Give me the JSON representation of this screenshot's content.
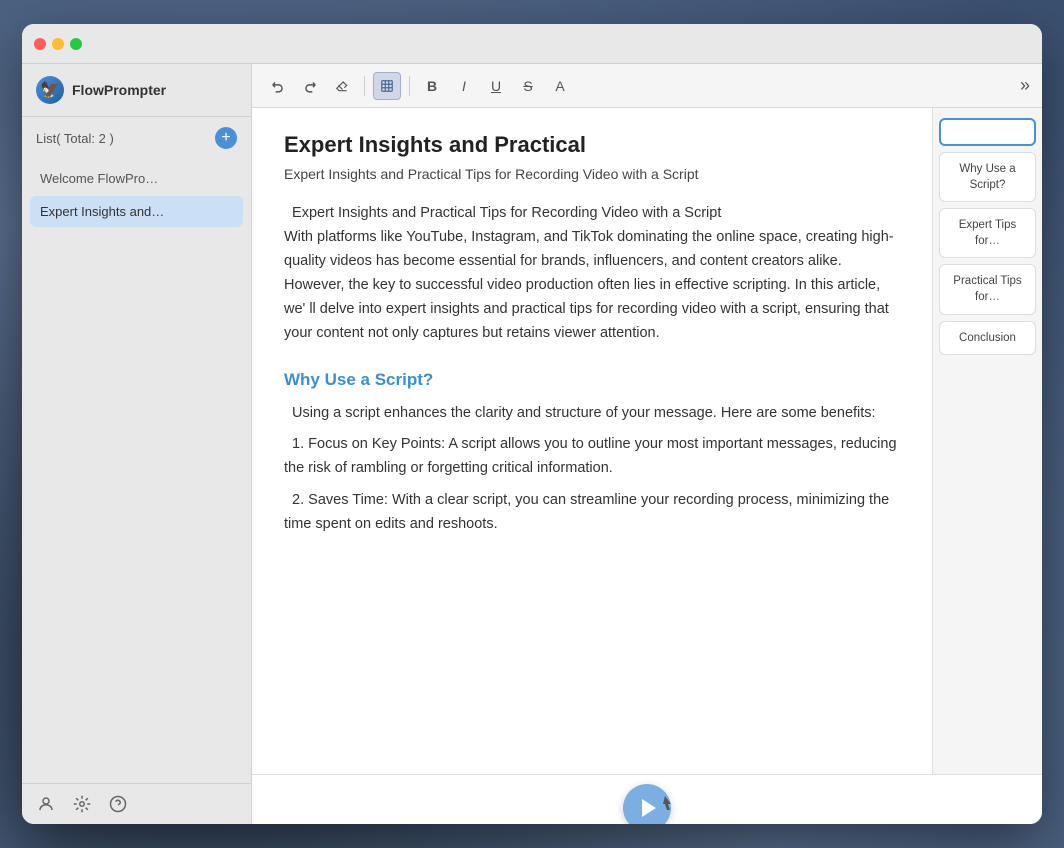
{
  "window": {
    "title": "FlowPrompter"
  },
  "sidebar": {
    "list_label": "List( Total: 2 )",
    "items": [
      {
        "id": "welcome",
        "label": "Welcome FlowPro…",
        "active": false
      },
      {
        "id": "expert",
        "label": "Expert Insights and…",
        "active": true
      }
    ],
    "add_button_label": "+"
  },
  "toolbar": {
    "buttons": [
      {
        "id": "undo",
        "label": "↩",
        "symbol": "↩",
        "active": false
      },
      {
        "id": "redo",
        "label": "↪",
        "symbol": "↪",
        "active": false
      },
      {
        "id": "erase",
        "label": "◇",
        "symbol": "◇",
        "active": false
      },
      {
        "id": "table",
        "label": "⊞",
        "symbol": "⊞",
        "active": true
      },
      {
        "id": "bold",
        "label": "B",
        "symbol": "B",
        "active": false
      },
      {
        "id": "italic",
        "label": "I",
        "symbol": "I",
        "active": false
      },
      {
        "id": "underline",
        "label": "U",
        "symbol": "U",
        "active": false
      },
      {
        "id": "strikethrough",
        "label": "S",
        "symbol": "S",
        "active": false
      },
      {
        "id": "font",
        "label": "A",
        "symbol": "A",
        "active": false
      }
    ],
    "more_label": "»"
  },
  "document": {
    "title": "Expert Insights and Practical",
    "subtitle": "Expert Insights and Practical Tips for Recording Video with a Script",
    "intro": "  Expert Insights and Practical Tips for Recording Video with a Script\nWith platforms like YouTube, Instagram, and TikTok dominating the online space, creating high-quality videos has become essential for brands, influencers, and content creators alike. However, the key to successful video production often lies in effective scripting. In this article, we'll delve into expert insights and practical tips for recording video with a script, ensuring that your content not only captures but retains viewer attention.",
    "section1": {
      "heading": "Why Use a Script?",
      "body": "  Using a script enhances the clarity and structure of your message. Here are some benefits:\n  1. Focus on Key Points: A script allows you to outline your most important messages, reducing the risk of rambling or forgetting critical information.\n  2. Saves Time: With a clear script, you can streamline your recording process, minimizing the time spent on edits and reshoots."
    }
  },
  "toc": {
    "items": [
      {
        "id": "toc-active",
        "label": "",
        "active": true
      },
      {
        "id": "why-use-script",
        "label": "Why Use a Script?",
        "active": false
      },
      {
        "id": "expert-tips",
        "label": "Expert Tips for…",
        "active": false
      },
      {
        "id": "practical-tips",
        "label": "Practical Tips for…",
        "active": false
      },
      {
        "id": "conclusion",
        "label": "Conclusion",
        "active": false
      }
    ]
  },
  "footer_icons": {
    "user": "👤",
    "settings": "⚙",
    "help": "💬"
  },
  "play_button": {
    "label": "▶"
  }
}
